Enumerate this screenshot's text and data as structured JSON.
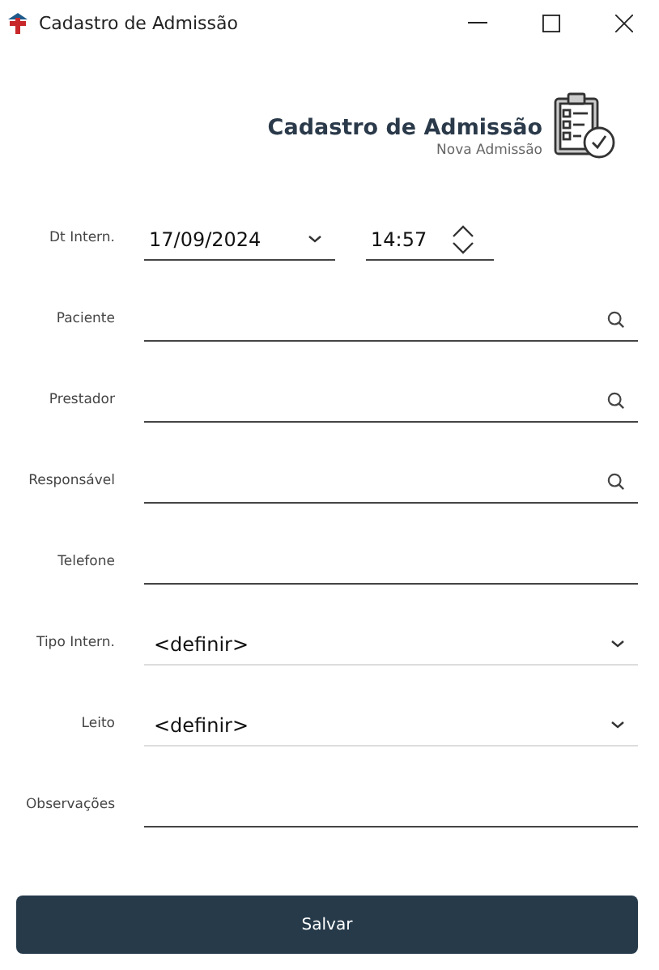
{
  "window": {
    "title": "Cadastro de Admissão"
  },
  "header": {
    "title": "Cadastro de Admissão",
    "subtitle": "Nova Admissão"
  },
  "fields": [
    {
      "kind": "datetime",
      "label": "Dt Intern.",
      "date": "17/09/2024",
      "time": "14:57"
    },
    {
      "kind": "search",
      "label": "Paciente"
    },
    {
      "kind": "search",
      "label": "Prestador"
    },
    {
      "kind": "search",
      "label": "Responsável"
    },
    {
      "kind": "text",
      "label": "Telefone"
    },
    {
      "kind": "select",
      "label": "Tipo Intern.",
      "value": "<definir>"
    },
    {
      "kind": "select",
      "label": "Leito",
      "value": "<definir>"
    },
    {
      "kind": "text",
      "label": "Observações"
    }
  ],
  "buttons": [
    {
      "label": "Salvar"
    }
  ]
}
